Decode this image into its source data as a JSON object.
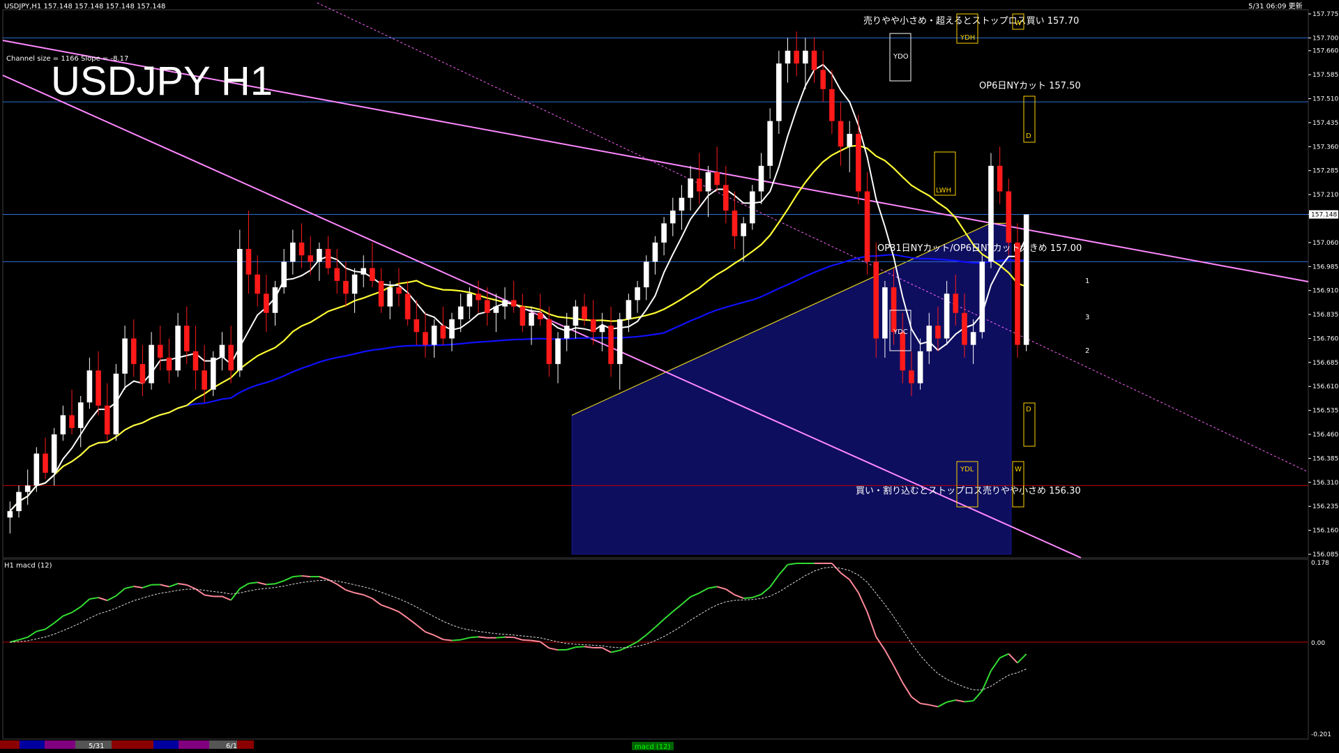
{
  "header": {
    "symbol_line": "USDJPY,H1  157.148 157.148 157.148 157.148",
    "datetime_label": "5/31 06:09 更新",
    "channel_info": "Channel size = 1166 Slope = -8.17",
    "big_title": "USDJPY H1"
  },
  "annotations": {
    "sell_note": "売りやや小さめ・超えるとストップロス買い 157.70",
    "op6_note": "OP6日NYカット 157.50",
    "op31_note": "OP31日NYカット/OP6日NYカット大きめ 157.00",
    "buy_note": "買い・割り込むとストップロス売りやや小さめ 156.30",
    "labels": [
      "YDH",
      "YDO",
      "YDC",
      "YDL",
      "LWH",
      "W",
      "D",
      "1",
      "2",
      "3"
    ]
  },
  "macd_panel": {
    "label": "H1  macd (12)",
    "ticks": [
      "0.178",
      "0.00",
      "-0.201"
    ]
  },
  "bottom_bar": {
    "dates": [
      "5/31",
      "6/1"
    ],
    "center_label": "macd (12)"
  },
  "chart_data": {
    "type": "candlestick",
    "title": "USDJPY H1",
    "ylim": [
      156.085,
      157.775
    ],
    "y_ticks": [
      "157.775",
      "157.700",
      "157.660",
      "157.585",
      "157.510",
      "157.435",
      "157.360",
      "157.285",
      "157.210",
      "157.148",
      "157.060",
      "156.985",
      "156.910",
      "156.835",
      "156.760",
      "156.685",
      "156.610",
      "156.535",
      "156.460",
      "156.385",
      "156.310",
      "156.235",
      "156.160",
      "156.085"
    ],
    "current_price": 157.148,
    "levels": [
      {
        "price": 157.7,
        "color": "#2d6fd6"
      },
      {
        "price": 157.5,
        "color": "#2d6fd6"
      },
      {
        "price": 157.148,
        "color": "#2d6fd6"
      },
      {
        "price": 157.0,
        "color": "#2d6fd6"
      },
      {
        "price": 156.3,
        "color": "#c00000"
      }
    ],
    "candles": [
      [
        156.2,
        156.25,
        156.15,
        156.22
      ],
      [
        156.22,
        156.3,
        156.2,
        156.28
      ],
      [
        156.28,
        156.35,
        156.24,
        156.3
      ],
      [
        156.3,
        156.42,
        156.28,
        156.4
      ],
      [
        156.4,
        156.45,
        156.32,
        156.34
      ],
      [
        156.34,
        156.48,
        156.3,
        156.46
      ],
      [
        156.46,
        156.55,
        156.44,
        156.52
      ],
      [
        156.52,
        156.6,
        156.46,
        156.48
      ],
      [
        156.48,
        156.58,
        156.42,
        156.56
      ],
      [
        156.56,
        156.7,
        156.54,
        156.66
      ],
      [
        156.66,
        156.72,
        156.52,
        156.55
      ],
      [
        156.55,
        156.62,
        156.44,
        156.46
      ],
      [
        156.46,
        156.68,
        156.44,
        156.65
      ],
      [
        156.65,
        156.8,
        156.6,
        156.76
      ],
      [
        156.76,
        156.82,
        156.64,
        156.68
      ],
      [
        156.68,
        156.74,
        156.58,
        156.62
      ],
      [
        156.62,
        156.78,
        156.6,
        156.74
      ],
      [
        156.74,
        156.8,
        156.66,
        156.7
      ],
      [
        156.7,
        156.76,
        156.62,
        156.66
      ],
      [
        156.66,
        156.84,
        156.64,
        156.8
      ],
      [
        156.8,
        156.86,
        156.68,
        156.72
      ],
      [
        156.72,
        156.8,
        156.6,
        156.66
      ],
      [
        156.66,
        156.74,
        156.56,
        156.6
      ],
      [
        156.6,
        156.72,
        156.58,
        156.7
      ],
      [
        156.7,
        156.78,
        156.66,
        156.74
      ],
      [
        156.74,
        156.8,
        156.62,
        156.66
      ],
      [
        156.66,
        157.1,
        156.64,
        157.04
      ],
      [
        157.04,
        157.16,
        156.9,
        156.96
      ],
      [
        156.96,
        157.02,
        156.86,
        156.9
      ],
      [
        156.9,
        156.96,
        156.78,
        156.84
      ],
      [
        156.84,
        156.94,
        156.8,
        156.92
      ],
      [
        156.92,
        157.04,
        156.9,
        157.0
      ],
      [
        157.0,
        157.1,
        156.96,
        157.06
      ],
      [
        157.06,
        157.12,
        156.98,
        157.02
      ],
      [
        157.02,
        157.08,
        156.96,
        157.0
      ],
      [
        157.0,
        157.06,
        156.94,
        157.04
      ],
      [
        157.04,
        157.08,
        156.96,
        156.98
      ],
      [
        156.98,
        157.04,
        156.9,
        156.94
      ],
      [
        156.94,
        157.0,
        156.86,
        156.9
      ],
      [
        156.9,
        156.98,
        156.84,
        156.96
      ],
      [
        156.96,
        157.02,
        156.92,
        156.98
      ],
      [
        156.98,
        157.06,
        156.92,
        156.94
      ],
      [
        156.94,
        156.98,
        156.84,
        156.86
      ],
      [
        156.86,
        156.94,
        156.82,
        156.92
      ],
      [
        156.92,
        156.98,
        156.86,
        156.9
      ],
      [
        156.9,
        156.94,
        156.8,
        156.82
      ],
      [
        156.82,
        156.88,
        156.74,
        156.78
      ],
      [
        156.78,
        156.84,
        156.7,
        156.74
      ],
      [
        156.74,
        156.82,
        156.7,
        156.8
      ],
      [
        156.8,
        156.86,
        156.74,
        156.76
      ],
      [
        156.76,
        156.84,
        156.72,
        156.82
      ],
      [
        156.82,
        156.9,
        156.78,
        156.86
      ],
      [
        156.86,
        156.92,
        156.82,
        156.9
      ],
      [
        156.9,
        156.94,
        156.84,
        156.88
      ],
      [
        156.88,
        156.92,
        156.8,
        156.84
      ],
      [
        156.84,
        156.9,
        156.78,
        156.86
      ],
      [
        156.86,
        156.92,
        156.82,
        156.88
      ],
      [
        156.88,
        156.94,
        156.84,
        156.86
      ],
      [
        156.86,
        156.9,
        156.78,
        156.8
      ],
      [
        156.8,
        156.86,
        156.74,
        156.84
      ],
      [
        156.84,
        156.9,
        156.8,
        156.82
      ],
      [
        156.82,
        156.86,
        156.64,
        156.68
      ],
      [
        156.68,
        156.78,
        156.62,
        156.76
      ],
      [
        156.76,
        156.84,
        156.72,
        156.8
      ],
      [
        156.8,
        156.88,
        156.76,
        156.86
      ],
      [
        156.86,
        156.9,
        156.8,
        156.82
      ],
      [
        156.82,
        156.88,
        156.74,
        156.78
      ],
      [
        156.78,
        156.84,
        156.72,
        156.8
      ],
      [
        156.8,
        156.86,
        156.64,
        156.68
      ],
      [
        156.68,
        156.84,
        156.6,
        156.82
      ],
      [
        156.82,
        156.9,
        156.78,
        156.88
      ],
      [
        156.88,
        156.94,
        156.84,
        156.92
      ],
      [
        156.92,
        157.02,
        156.88,
        157.0
      ],
      [
        157.0,
        157.08,
        156.96,
        157.06
      ],
      [
        157.06,
        157.14,
        157.02,
        157.12
      ],
      [
        157.12,
        157.2,
        157.08,
        157.16
      ],
      [
        157.16,
        157.24,
        157.1,
        157.2
      ],
      [
        157.2,
        157.3,
        157.16,
        157.26
      ],
      [
        157.26,
        157.34,
        157.18,
        157.22
      ],
      [
        157.22,
        157.3,
        157.14,
        157.28
      ],
      [
        157.28,
        157.36,
        157.22,
        157.24
      ],
      [
        157.24,
        157.3,
        157.12,
        157.16
      ],
      [
        157.16,
        157.22,
        157.04,
        157.08
      ],
      [
        157.08,
        157.14,
        157.0,
        157.12
      ],
      [
        157.12,
        157.24,
        157.1,
        157.22
      ],
      [
        157.22,
        157.34,
        157.18,
        157.3
      ],
      [
        157.3,
        157.48,
        157.26,
        157.44
      ],
      [
        157.44,
        157.66,
        157.4,
        157.62
      ],
      [
        157.62,
        157.7,
        157.56,
        157.66
      ],
      [
        157.66,
        157.72,
        157.58,
        157.62
      ],
      [
        157.62,
        157.7,
        157.54,
        157.66
      ],
      [
        157.66,
        157.7,
        157.56,
        157.6
      ],
      [
        157.6,
        157.66,
        157.5,
        157.54
      ],
      [
        157.54,
        157.6,
        157.4,
        157.44
      ],
      [
        157.44,
        157.5,
        157.3,
        157.36
      ],
      [
        157.36,
        157.44,
        157.28,
        157.4
      ],
      [
        157.4,
        157.46,
        157.18,
        157.22
      ],
      [
        157.22,
        157.28,
        156.96,
        157.0
      ],
      [
        157.0,
        157.06,
        156.7,
        156.76
      ],
      [
        156.76,
        156.94,
        156.7,
        156.92
      ],
      [
        156.92,
        156.98,
        156.74,
        156.78
      ],
      [
        156.78,
        156.84,
        156.62,
        156.66
      ],
      [
        156.66,
        156.72,
        156.58,
        156.62
      ],
      [
        156.62,
        156.76,
        156.6,
        156.72
      ],
      [
        156.72,
        156.84,
        156.68,
        156.8
      ],
      [
        156.8,
        156.86,
        156.72,
        156.76
      ],
      [
        156.76,
        156.94,
        156.74,
        156.9
      ],
      [
        156.9,
        156.96,
        156.8,
        156.84
      ],
      [
        156.84,
        156.9,
        156.7,
        156.74
      ],
      [
        156.74,
        156.82,
        156.68,
        156.78
      ],
      [
        156.78,
        157.02,
        156.76,
        157.0
      ],
      [
        157.0,
        157.34,
        156.98,
        157.3
      ],
      [
        157.3,
        157.36,
        157.18,
        157.22
      ],
      [
        157.22,
        157.26,
        157.02,
        157.06
      ],
      [
        157.06,
        157.12,
        156.7,
        156.74
      ],
      [
        156.74,
        157.14,
        156.72,
        157.148
      ]
    ],
    "text_labels": {
      "title": "USDJPY H1",
      "channel": "Channel size = 1166 Slope = -8.17"
    }
  }
}
